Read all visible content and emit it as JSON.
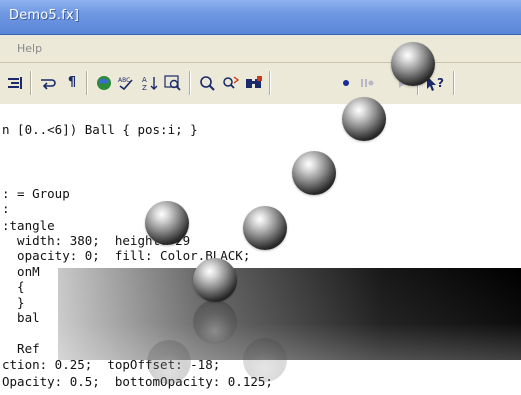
{
  "window": {
    "title": "Demo5.fx]"
  },
  "menu": {
    "items": [
      "Help"
    ]
  },
  "toolbar": {
    "icons": [
      "align-right-icon",
      "wrap-icon",
      "paragraph-icon",
      "globe-icon",
      "spellcheck-icon",
      "sort-icon",
      "zoom-icon",
      "find-icon",
      "replace-icon",
      "binoculars-icon",
      "record-icon",
      "pause-icon",
      "play-icon",
      "help-cursor-icon"
    ]
  },
  "code": {
    "lines": [
      "n [0..<6]) Ball { pos:i; }",
      "",
      "",
      "",
      ": = Group",
      ":",
      ":tangle",
      "  width: 380;  height: 29",
      "  opacity: 0;  fill: Color.BLACK;",
      "  onM",
      "  {",
      "  }",
      "  bal",
      "",
      "  Ref",
      "ction: 0.25;  topOffset: -18;",
      "Opacity: 0.5;  bottomOpacity: 0.125;"
    ]
  },
  "colors": {
    "titlebar": "#6f98e3",
    "chrome": "#ece9d8",
    "reflection_dark": "#000000"
  }
}
